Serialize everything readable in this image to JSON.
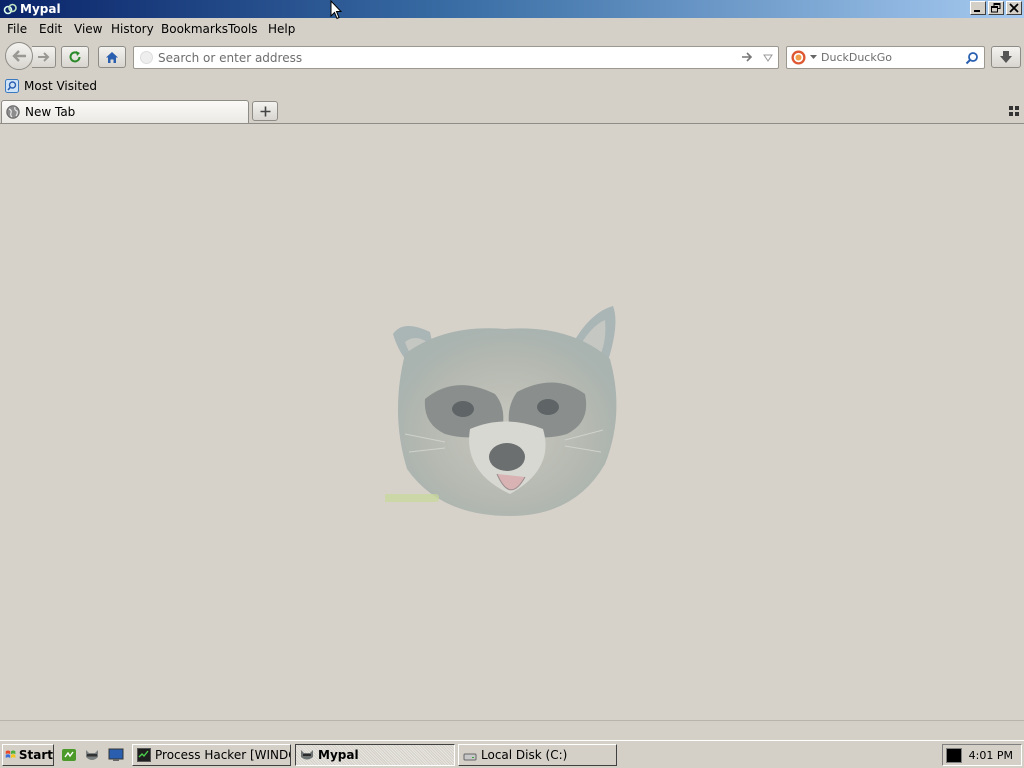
{
  "window": {
    "title": "Mypal",
    "icon": "mypal-icon",
    "controls": [
      "minimize-icon",
      "restore-icon",
      "close-icon"
    ]
  },
  "menu": {
    "file": "File",
    "edit": "Edit",
    "view": "View",
    "history": "History",
    "bookmarks": "Bookmarks",
    "tools": "Tools",
    "help": "Help"
  },
  "navbar": {
    "back_icon": "back-arrow-icon",
    "forward_icon": "forward-arrow-icon",
    "reload_icon": "reload-icon",
    "home_icon": "home-icon",
    "download_icon": "download-icon",
    "url": {
      "value": "",
      "placeholder": "Search or enter address"
    },
    "search": {
      "engine": "DuckDuckGo",
      "placeholder": "DuckDuckGo",
      "value": ""
    }
  },
  "bookmarks_bar": {
    "items": [
      {
        "label": "Most Visited",
        "icon": "most-visited-icon"
      }
    ]
  },
  "tabs": {
    "items": [
      {
        "label": "New Tab",
        "icon": "globe-icon",
        "active": true
      }
    ],
    "new_tab_icon": "plus-icon",
    "list_all_icon": "tab-grid-icon"
  },
  "content": {
    "image": "raccoon-logo"
  },
  "taskbar": {
    "start_label": "Start",
    "quick_launch": [
      "green-app-icon",
      "raccoon-icon",
      "desktop-icon"
    ],
    "buttons": [
      {
        "label": "Process Hacker [WINDO...",
        "icon": "process-hacker-icon",
        "active": false
      },
      {
        "label": "Mypal",
        "icon": "mypal-icon",
        "active": true
      },
      {
        "label": "Local Disk (C:)",
        "icon": "drive-icon",
        "active": false
      }
    ],
    "clock": "4:01 PM"
  },
  "colors": {
    "titlebar_start": "#0a246a",
    "titlebar_end": "#a6caf0",
    "chrome": "#d4d0c8",
    "content_bg": "#d6d2ca"
  }
}
